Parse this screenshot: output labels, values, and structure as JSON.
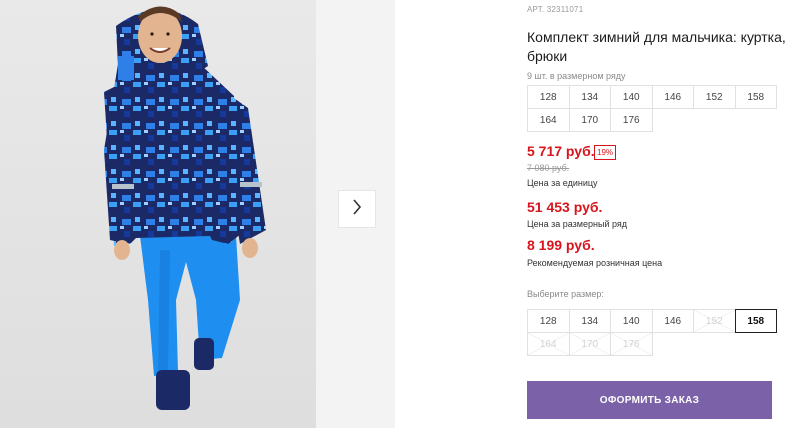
{
  "gallery": {
    "image_alt": "Комплект зимний для мальчика",
    "next_icon": "chevron-right-icon"
  },
  "product": {
    "article": "АРТ. 32311071",
    "title": "Комплект зимний для мальчика: куртка, брюки",
    "pack_info": "9 шт. в размерном ряду",
    "size_row": [
      "128",
      "134",
      "140",
      "146",
      "152",
      "158",
      "164",
      "170",
      "176"
    ],
    "price_unit": "5 717 руб.",
    "discount": "19%",
    "price_old": "7 080 руб.",
    "price_unit_label": "Цена за единицу",
    "price_row": "51 453 руб.",
    "price_row_label": "Цена за размерный ряд",
    "price_retail": "8 199 руб.",
    "price_retail_label": "Рекомендуемая розничная цена",
    "choose_label": "Выберите размер:",
    "size_options": [
      {
        "label": "128",
        "state": "available"
      },
      {
        "label": "134",
        "state": "available"
      },
      {
        "label": "140",
        "state": "available"
      },
      {
        "label": "146",
        "state": "available"
      },
      {
        "label": "152",
        "state": "disabled"
      },
      {
        "label": "158",
        "state": "selected"
      },
      {
        "label": "164",
        "state": "disabled"
      },
      {
        "label": "170",
        "state": "disabled"
      },
      {
        "label": "176",
        "state": "disabled"
      }
    ],
    "order_button": "ОФОРМИТЬ ЗАКАЗ"
  },
  "colors": {
    "price_red": "#d8151d",
    "button_purple": "#7b62a8",
    "jacket_navy": "#1b2a66",
    "pants_blue": "#1e8ff0"
  }
}
